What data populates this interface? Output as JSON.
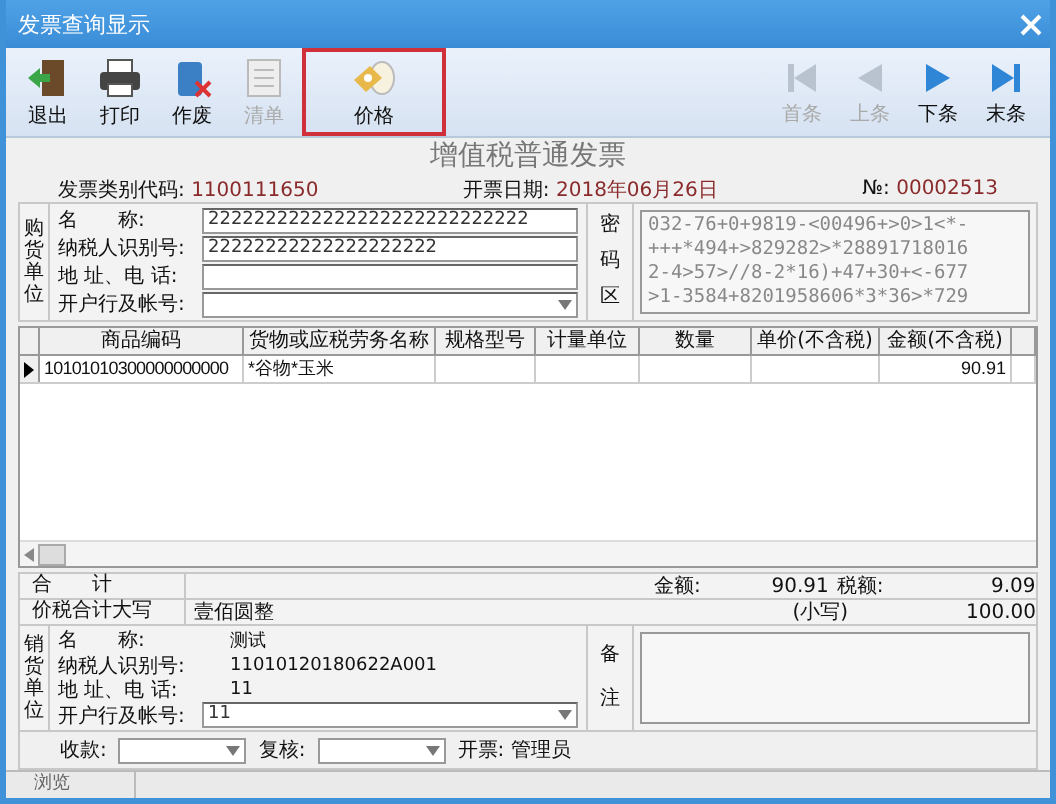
{
  "window": {
    "title": "发票查询显示"
  },
  "toolbar": {
    "items": [
      {
        "kind": "exit",
        "label": "退出",
        "disabled": false,
        "highlighted": false
      },
      {
        "kind": "print",
        "label": "打印",
        "disabled": false,
        "highlighted": false
      },
      {
        "kind": "void",
        "label": "作废",
        "disabled": false,
        "highlighted": false
      },
      {
        "kind": "list",
        "label": "清单",
        "disabled": true,
        "highlighted": false
      },
      {
        "kind": "price",
        "label": "价格",
        "disabled": false,
        "highlighted": true
      }
    ],
    "nav": [
      {
        "kind": "first",
        "label": "首条",
        "disabled": true
      },
      {
        "kind": "prev",
        "label": "上条",
        "disabled": true
      },
      {
        "kind": "next",
        "label": "下条",
        "disabled": false
      },
      {
        "kind": "last",
        "label": "末条",
        "disabled": false
      }
    ]
  },
  "invoice": {
    "title": "增值税普通发票",
    "info": [
      {
        "label": "发票类别代码:",
        "value": "1100111650"
      },
      {
        "label": "开票日期:",
        "value": "2018年06月26日"
      },
      {
        "label": "№:",
        "value": "00002513"
      }
    ]
  },
  "buyer": {
    "section_label": "购货单位",
    "fields": [
      {
        "kind": "input",
        "label": "名　　称:",
        "value": "2222222222222222222222222222"
      },
      {
        "kind": "input",
        "label": "纳税人识别号:",
        "value": "22222222222222222222"
      },
      {
        "kind": "input",
        "label": "地 址、电 话:"
      },
      {
        "kind": "select",
        "label": "开户行及帐号:"
      }
    ],
    "cipher_label": "密码区",
    "cipher_lines": [
      "032-76+0+9819-<00496+>0>1<*-",
      "+++*494+>829282>*28891718016",
      "2-4>57>//8-2*16)+47+30+<-677",
      ">1-3584+8201958606*3*36>*729"
    ]
  },
  "table": {
    "columns": [
      "商品编码",
      "货物或应税劳务名称",
      "规格型号",
      "计量单位",
      "数量",
      "单价(不含税)",
      "金额(不含税)"
    ],
    "rows": [
      {
        "selected": true,
        "cells": [
          "10101010300000000000",
          "*谷物*玉米",
          "",
          "",
          "",
          "",
          "90.91"
        ]
      }
    ]
  },
  "totals": {
    "total_label": "合　　计",
    "amount_label": "金额:",
    "amount": "90.91",
    "tax_label": "税额:",
    "tax": "9.09",
    "caps_label": "价税合计大写",
    "caps_value": "壹佰圆整",
    "small_label": "(小写)",
    "small_value": "100.00"
  },
  "seller": {
    "section_label": "销货单位",
    "fields": [
      {
        "kind": "plain",
        "label": "名　　称:",
        "value": "测试"
      },
      {
        "kind": "plain",
        "label": "纳税人识别号:",
        "value": "11010120180622A001"
      },
      {
        "kind": "plain",
        "label": "地 址、电 话:",
        "value": "11"
      },
      {
        "kind": "select",
        "label": "开户行及帐号:",
        "value": "11"
      }
    ],
    "remark_label": "备注"
  },
  "footer": [
    {
      "kind": "select",
      "label": "收款:"
    },
    {
      "kind": "select",
      "label": "复核:"
    },
    {
      "kind": "plain",
      "label": "开票:",
      "value": "管理员"
    }
  ],
  "status_bar": {
    "mode": "浏览"
  }
}
